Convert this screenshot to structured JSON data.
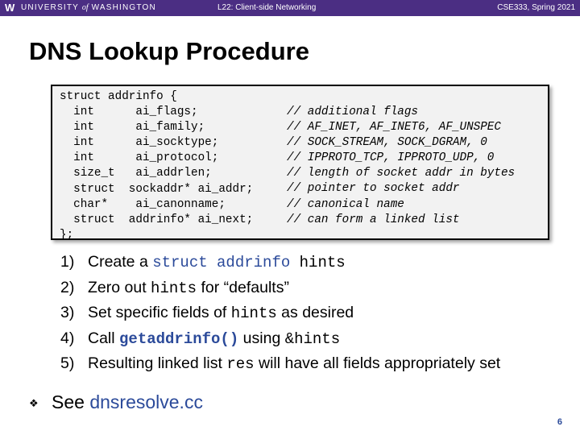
{
  "header": {
    "logo": "W",
    "university_pre": "UNIVERSITY ",
    "university_of": "of",
    "university_post": " WASHINGTON",
    "lecture": "L22: Client-side Networking",
    "course": "CSE333, Spring 2021"
  },
  "slide": {
    "title": "DNS Lookup Procedure",
    "code": "struct addrinfo {\n  int      ai_flags;\n  int      ai_family;\n  int      ai_socktype;\n  int      ai_protocol;\n  size_t   ai_addrlen;\n  struct  sockaddr* ai_addr;\n  char*    ai_canonname;\n  struct  addrinfo* ai_next;\n};",
    "code_comments": "// additional flags\n// AF_INET, AF_INET6, AF_UNSPEC\n// SOCK_STREAM, SOCK_DGRAM, 0\n// IPPROTO_TCP, IPPROTO_UDP, 0\n// length of socket addr in bytes\n// pointer to socket addr\n// canonical name\n// can form a linked list",
    "steps": [
      {
        "num": "1)",
        "parts": [
          "Create a ",
          "struct addrinfo",
          " hints",
          ""
        ]
      },
      {
        "num": "2)",
        "parts": [
          "Zero out ",
          "hints",
          " for “defaults”",
          ""
        ]
      },
      {
        "num": "3)",
        "parts": [
          "Set specific fields of ",
          "hints",
          " as desired",
          ""
        ]
      },
      {
        "num": "4)",
        "parts": [
          "Call ",
          "getaddrinfo()",
          " using ",
          "&hints"
        ]
      },
      {
        "num": "5)",
        "parts": [
          "Resulting linked list ",
          "res",
          " will have all fields appropriately set",
          ""
        ]
      }
    ],
    "bullet_diamond": "❖",
    "bullet_text": "See ",
    "bullet_link": "dnsresolve.cc",
    "page_number": "6"
  },
  "colors": {
    "header_bg": "#4b2e83",
    "code_bg": "#f2f2f2",
    "accent_blue": "#2b4a9a"
  }
}
